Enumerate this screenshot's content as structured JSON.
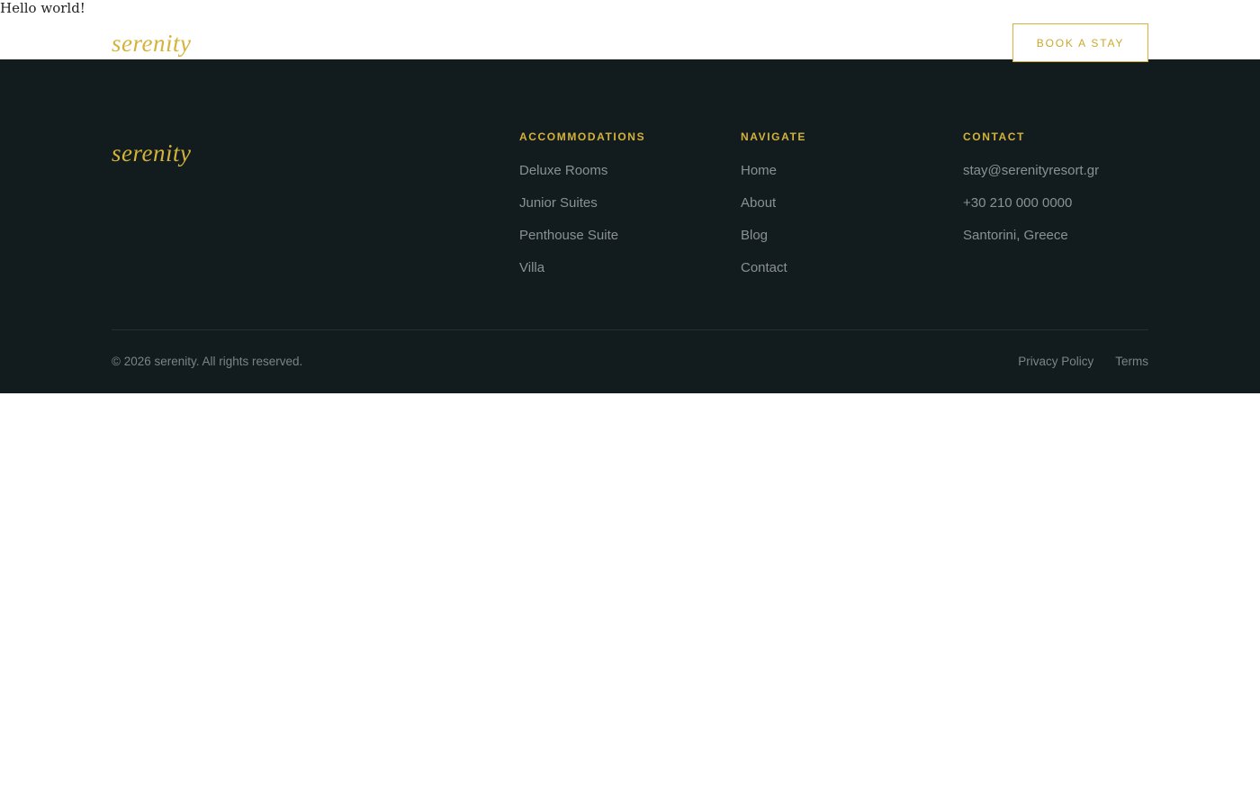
{
  "page": {
    "hello_text": "Hello world!"
  },
  "header": {
    "brand": "serenity",
    "book_button": "BOOK A STAY"
  },
  "footer": {
    "brand": "serenity",
    "columns": [
      {
        "heading": "ACCOMMODATIONS",
        "items": [
          "Deluxe Rooms",
          "Junior Suites",
          "Penthouse Suite",
          "Villa"
        ]
      },
      {
        "heading": "NAVIGATE",
        "items": [
          "Home",
          "About",
          "Blog",
          "Contact"
        ]
      },
      {
        "heading": "CONTACT",
        "items": [
          "stay@serenityresort.gr",
          "+30 210 000 0000",
          "Santorini, Greece"
        ]
      }
    ],
    "copyright": "© 2026 serenity. All rights reserved.",
    "legal_links": [
      "Privacy Policy",
      "Terms"
    ]
  },
  "colors": {
    "accent": "#d4b33a",
    "footer_bg": "#121b1d",
    "muted_text": "#8a9194"
  }
}
